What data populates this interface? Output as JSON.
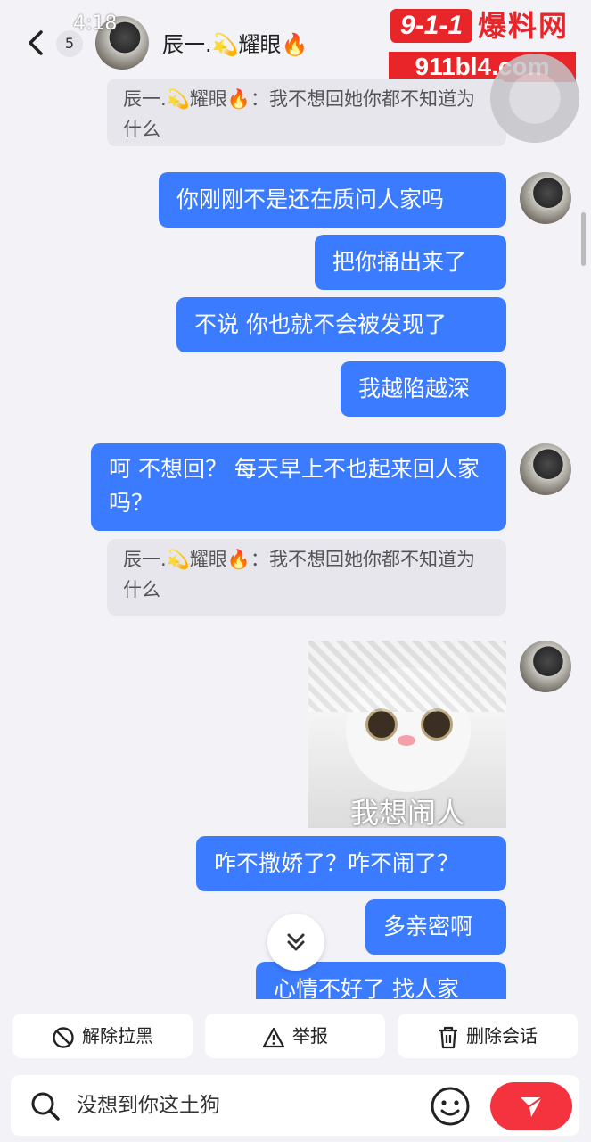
{
  "status": {
    "time": "4:18"
  },
  "header": {
    "back_icon": "chevron-left-icon",
    "unread_count": "5",
    "name": "辰一.💫耀眼🔥"
  },
  "watermark": {
    "logo": "9-1-1",
    "cn": "爆料网",
    "url": "911bl4.com"
  },
  "messages": {
    "quote1": "辰一.💫耀眼🔥：我不想回她你都不知道为什么",
    "b1": "你刚刚不是还在质问人家吗",
    "b2": "把你捅出来了",
    "b3": "不说 你也就不会被发现了",
    "b4": "我越陷越深",
    "b5": "呵 不想回？ 每天早上不也起来回人家吗？",
    "quote2": "辰一.💫耀眼🔥：我不想回她你都不知道为什么",
    "sticker_caption": "我想闹人",
    "b6": "咋不撒娇了？咋不闹了？",
    "b7": "多亲密啊",
    "b8": "心情不好了 找人家"
  },
  "actions": {
    "unblock": "解除拉黑",
    "report": "举报",
    "delete": "删除会话"
  },
  "input": {
    "value": "没想到你这土狗"
  },
  "colors": {
    "bubble": "#3a7bff",
    "send": "#f5333f",
    "watermark": "#e8262a"
  }
}
